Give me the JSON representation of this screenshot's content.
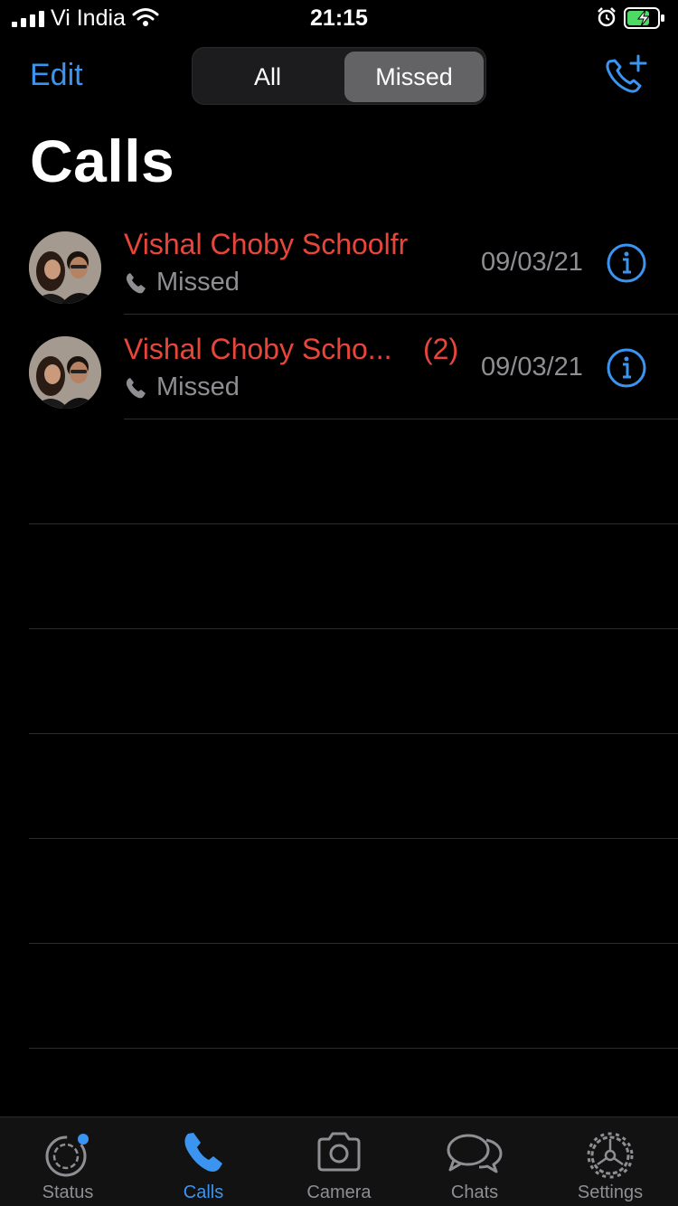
{
  "status_bar": {
    "carrier": "Vi India",
    "time": "21:15"
  },
  "header": {
    "edit_label": "Edit",
    "segments": [
      "All",
      "Missed"
    ],
    "selected_segment": "Missed",
    "title": "Calls"
  },
  "calls": [
    {
      "name": "Vishal Choby Schoolfr",
      "count": "",
      "type": "Missed",
      "date": "09/03/21"
    },
    {
      "name": "Vishal Choby Scho...",
      "count": "(2)",
      "type": "Missed",
      "date": "09/03/21"
    }
  ],
  "tabbar": {
    "tabs": [
      {
        "label": "Status",
        "icon": "status-icon"
      },
      {
        "label": "Calls",
        "icon": "phone-icon"
      },
      {
        "label": "Camera",
        "icon": "camera-icon"
      },
      {
        "label": "Chats",
        "icon": "chats-icon"
      },
      {
        "label": "Settings",
        "icon": "gear-icon"
      }
    ],
    "active": "Calls"
  },
  "colors": {
    "accent": "#3b94f0",
    "missed": "#e8463a",
    "secondary_text": "#8e8e93",
    "battery_charging": "#4cd964"
  }
}
